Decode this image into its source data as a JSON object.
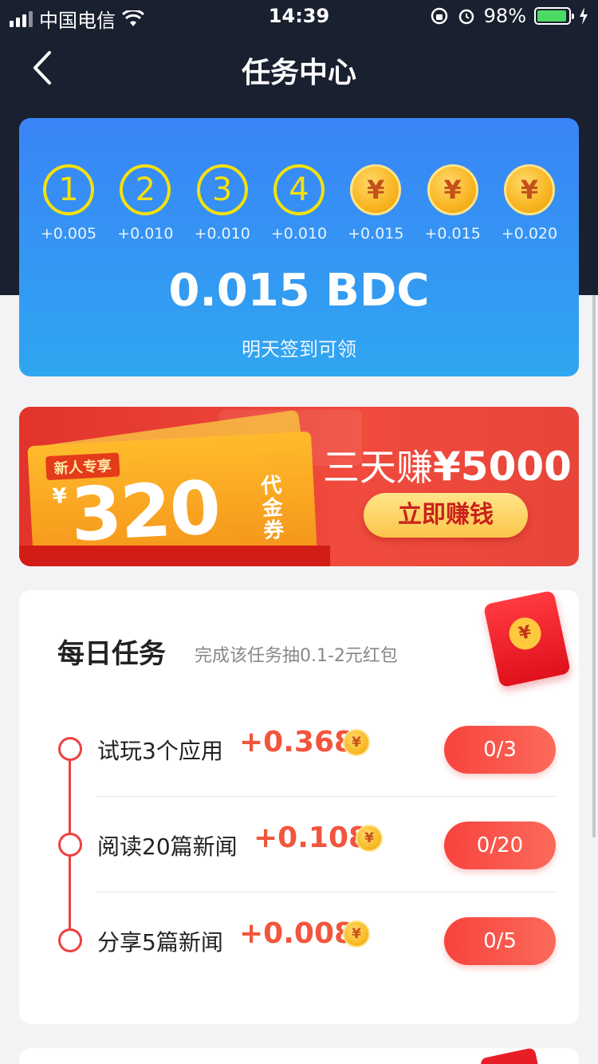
{
  "status_bar": {
    "carrier": "中国电信",
    "time": "14:39",
    "battery": "98%"
  },
  "nav": {
    "title": "任务中心"
  },
  "checkin": {
    "days": [
      {
        "label": "1",
        "reward": "+0.005",
        "kind": "number"
      },
      {
        "label": "2",
        "reward": "+0.010",
        "kind": "number"
      },
      {
        "label": "3",
        "reward": "+0.010",
        "kind": "number"
      },
      {
        "label": "4",
        "reward": "+0.010",
        "kind": "number"
      },
      {
        "label": "¥",
        "reward": "+0.015",
        "kind": "coin"
      },
      {
        "label": "¥",
        "reward": "+0.015",
        "kind": "coin"
      },
      {
        "label": "¥",
        "reward": "+0.020",
        "kind": "coin"
      }
    ],
    "amount": "0.015 BDC",
    "subtitle": "明天签到可领"
  },
  "promo": {
    "badge": "新人专享",
    "yen": "¥",
    "ticket_amount": "320",
    "ticket_unit": "代金券",
    "headline_prefix": "三天赚",
    "headline_amount": "¥5000",
    "button": "立即赚钱"
  },
  "daily_tasks": {
    "title": "每日任务",
    "subtitle": "完成该任务抽0.1-2元红包",
    "redpacket_symbol": "¥",
    "items": [
      {
        "name": "试玩3个应用",
        "reward": "+0.368",
        "coin": "¥",
        "progress": "0/3"
      },
      {
        "name": "阅读20篇新闻",
        "reward": "+0.108",
        "coin": "¥",
        "progress": "0/20"
      },
      {
        "name": "分享5篇新闻",
        "reward": "+0.008",
        "coin": "¥",
        "progress": "0/5"
      }
    ]
  },
  "colors": {
    "header_bg": "#19202f",
    "checkin_gradient_top": "#3a84f7",
    "checkin_gradient_bottom": "#2fa6f0",
    "accent_red": "#f2553d",
    "coin_gold": "#f8b520"
  }
}
